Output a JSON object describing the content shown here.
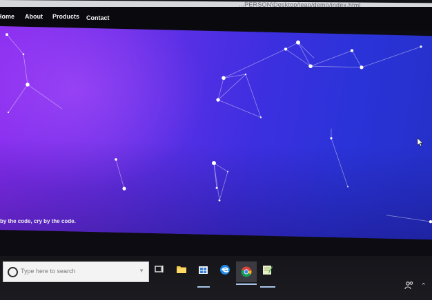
{
  "browser": {
    "url": "...PERSON\\Desktop/leap/demo/index.html"
  },
  "nav": {
    "items": [
      {
        "label": "Home"
      },
      {
        "label": "About"
      },
      {
        "label": "Products"
      },
      {
        "label": "Contact"
      }
    ]
  },
  "footer": {
    "text": "by the code, cry by the code."
  },
  "taskbar": {
    "search_placeholder": "Type here to search",
    "pinned": [
      "task-view-icon",
      "file-explorer-icon",
      "store-icon",
      "edge-icon",
      "chrome-icon",
      "notepad-icon"
    ]
  },
  "colors": {
    "hero_start": "#8a2cf0",
    "hero_end": "#2430c8",
    "particle": "#ffffff"
  }
}
